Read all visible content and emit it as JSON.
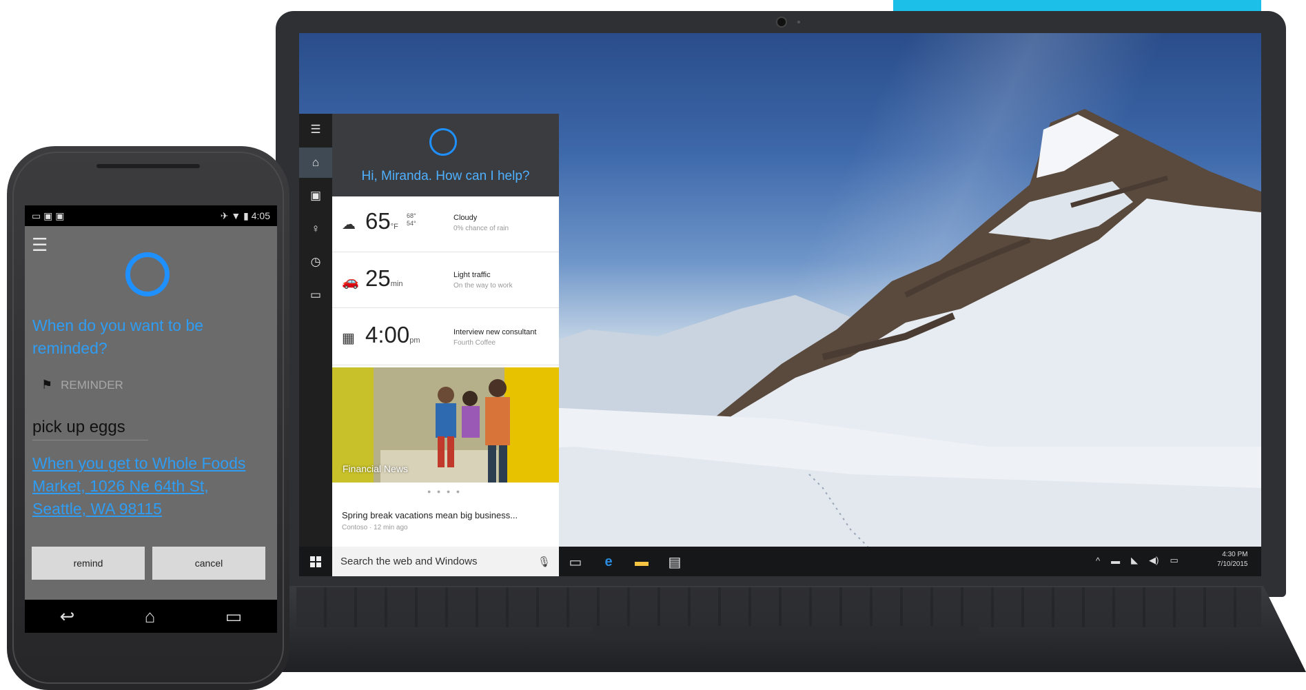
{
  "laptop": {
    "cortana": {
      "rail_icons": [
        "hamburger-icon",
        "home-icon",
        "notebook-icon",
        "lightbulb-icon",
        "history-icon",
        "feedback-icon"
      ],
      "greeting": "Hi, Miranda. How can I help?",
      "cards": [
        {
          "icon": "cloud-icon",
          "big": "65",
          "unit": "°F",
          "extra1": "68°",
          "extra2": "54°",
          "title": "Cloudy",
          "subtitle": "0% chance of rain"
        },
        {
          "icon": "car-icon",
          "big": "25",
          "unit": "min",
          "extra1": "",
          "extra2": "",
          "title": "Light traffic",
          "subtitle": "On the way to work"
        },
        {
          "icon": "calendar-icon",
          "big": "4:00",
          "unit": "pm",
          "extra1": "",
          "extra2": "",
          "title": "Interview new consultant",
          "subtitle": "Fourth Coffee"
        }
      ],
      "news": {
        "image_label": "Financial News",
        "title": "Spring break vacations mean big business...",
        "source": "Contoso · 12 min ago"
      }
    },
    "taskbar": {
      "search_placeholder": "Search the web and Windows",
      "time": "4:30 PM",
      "date": "7/10/2015"
    }
  },
  "phone": {
    "status_time": "4:05",
    "question": "When do you want to be reminded?",
    "reminder_label": "REMINDER",
    "task": "pick up eggs",
    "location": "When you get to Whole Foods Market, 1026 Ne 64th St, Seattle, WA 98115",
    "remind_button": "remind",
    "cancel_button": "cancel"
  },
  "colors": {
    "cortana_blue": "#1e90ff",
    "accent_cyan": "#1cbfe8"
  }
}
